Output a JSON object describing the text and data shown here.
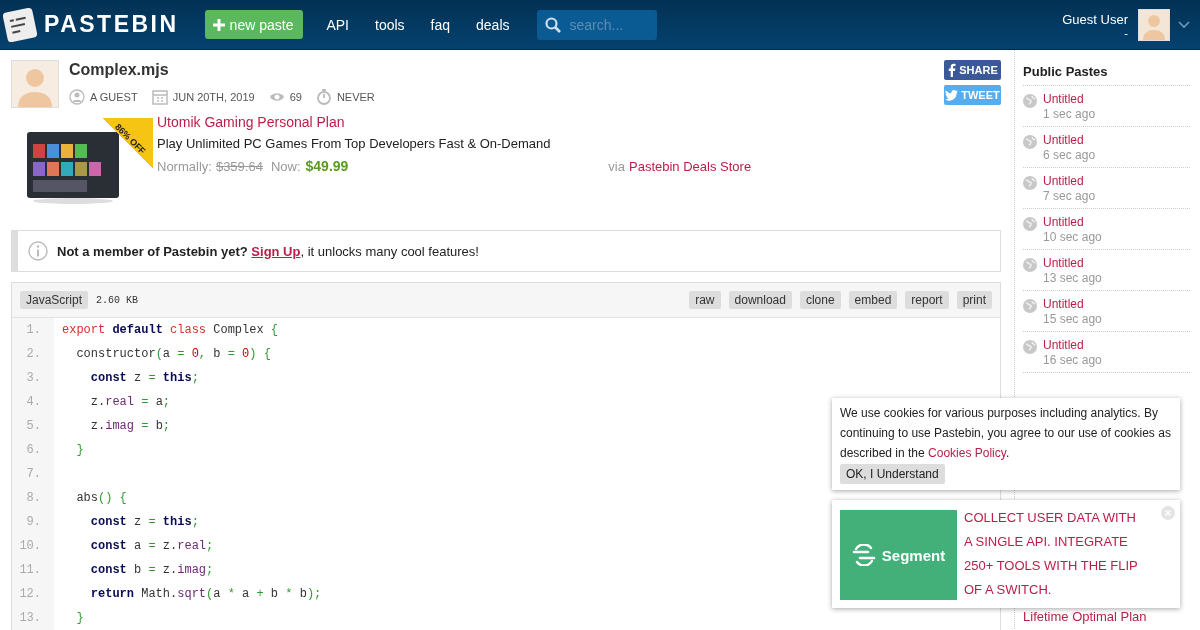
{
  "header": {
    "logo_text": "PASTEBIN",
    "new_paste": "new paste",
    "nav": [
      "API",
      "tools",
      "faq",
      "deals"
    ],
    "search": {
      "placeholder": "search..."
    },
    "user": {
      "name": "Guest User",
      "sub": "-"
    }
  },
  "paste": {
    "title": "Complex.mjs",
    "meta": [
      {
        "kind": "user",
        "text": "A GUEST"
      },
      {
        "kind": "date",
        "text": "JUN 20TH, 2019"
      },
      {
        "kind": "views",
        "text": "69"
      },
      {
        "kind": "expire",
        "text": "NEVER"
      }
    ],
    "share": [
      {
        "kind": "facebook",
        "label": "SHARE"
      },
      {
        "kind": "twitter",
        "label": "TWEET"
      }
    ]
  },
  "deal": {
    "badge": "86% OFF",
    "title": "Utomik Gaming Personal Plan",
    "subtitle": "Play Unlimited PC Games From Top Developers Fast & On-Demand",
    "normally_label": "Normally:",
    "old_price": "$359.64",
    "now_label": "Now:",
    "price": "$49.99",
    "via": "via",
    "store": "Pastebin Deals Store"
  },
  "notice": {
    "text": "Not a member of Pastebin yet?",
    "link": "Sign Up",
    "rest": ", it unlocks many cool features!"
  },
  "code": {
    "language": "JavaScript",
    "size": "2.60 KB",
    "actions": [
      "raw",
      "download",
      "clone",
      "embed",
      "report",
      "print"
    ],
    "lines": [
      {
        "n": "1.",
        "tokens": [
          {
            "t": "export",
            "kind": "keyword"
          },
          {
            "t": " default",
            "kind": "reserved"
          },
          {
            "t": " class",
            "kind": "keyword"
          },
          {
            "t": " Complex ",
            "kind": "plain"
          },
          {
            "t": "{",
            "kind": "punct"
          }
        ]
      },
      {
        "n": "2.",
        "tokens": [
          {
            "t": "  constructor",
            "kind": "plain"
          },
          {
            "t": "(",
            "kind": "punct"
          },
          {
            "t": "a ",
            "kind": "plain"
          },
          {
            "t": "=",
            "kind": "punct"
          },
          {
            "t": " 0",
            "kind": "number"
          },
          {
            "t": ",",
            "kind": "punct"
          },
          {
            "t": " b ",
            "kind": "plain"
          },
          {
            "t": "=",
            "kind": "punct"
          },
          {
            "t": " 0",
            "kind": "number"
          },
          {
            "t": ")",
            "kind": "punct"
          },
          {
            "t": " {",
            "kind": "punct"
          }
        ]
      },
      {
        "n": "3.",
        "tokens": [
          {
            "t": "    const",
            "kind": "reserved"
          },
          {
            "t": " z ",
            "kind": "plain"
          },
          {
            "t": "=",
            "kind": "punct"
          },
          {
            "t": " this",
            "kind": "reserved"
          },
          {
            "t": ";",
            "kind": "punct"
          }
        ]
      },
      {
        "n": "4.",
        "tokens": [
          {
            "t": "    z.",
            "kind": "plain"
          },
          {
            "t": "real",
            "kind": "property"
          },
          {
            "t": " =",
            "kind": "punct"
          },
          {
            "t": " a",
            "kind": "plain"
          },
          {
            "t": ";",
            "kind": "punct"
          }
        ]
      },
      {
        "n": "5.",
        "tokens": [
          {
            "t": "    z.",
            "kind": "plain"
          },
          {
            "t": "imag",
            "kind": "property"
          },
          {
            "t": " =",
            "kind": "punct"
          },
          {
            "t": " b",
            "kind": "plain"
          },
          {
            "t": ";",
            "kind": "punct"
          }
        ]
      },
      {
        "n": "6.",
        "tokens": [
          {
            "t": "  }",
            "kind": "punct"
          }
        ]
      },
      {
        "n": "7."
      },
      {
        "n": "8.",
        "tokens": [
          {
            "t": "  abs",
            "kind": "plain"
          },
          {
            "t": "()",
            "kind": "punct"
          },
          {
            "t": " {",
            "kind": "punct"
          }
        ]
      },
      {
        "n": "9.",
        "tokens": [
          {
            "t": "    const",
            "kind": "reserved"
          },
          {
            "t": " z ",
            "kind": "plain"
          },
          {
            "t": "=",
            "kind": "punct"
          },
          {
            "t": " this",
            "kind": "reserved"
          },
          {
            "t": ";",
            "kind": "punct"
          }
        ]
      },
      {
        "n": "10.",
        "tokens": [
          {
            "t": "    const",
            "kind": "reserved"
          },
          {
            "t": " a ",
            "kind": "plain"
          },
          {
            "t": "=",
            "kind": "punct"
          },
          {
            "t": " z.",
            "kind": "plain"
          },
          {
            "t": "real",
            "kind": "property"
          },
          {
            "t": ";",
            "kind": "punct"
          }
        ]
      },
      {
        "n": "11.",
        "tokens": [
          {
            "t": "    const",
            "kind": "reserved"
          },
          {
            "t": " b ",
            "kind": "plain"
          },
          {
            "t": "=",
            "kind": "punct"
          },
          {
            "t": " z.",
            "kind": "plain"
          },
          {
            "t": "imag",
            "kind": "property"
          },
          {
            "t": ";",
            "kind": "punct"
          }
        ]
      },
      {
        "n": "12.",
        "tokens": [
          {
            "t": "    return",
            "kind": "reserved"
          },
          {
            "t": " Math.",
            "kind": "plain"
          },
          {
            "t": "sqrt",
            "kind": "property"
          },
          {
            "t": "(",
            "kind": "punct"
          },
          {
            "t": "a ",
            "kind": "plain"
          },
          {
            "t": "*",
            "kind": "punct"
          },
          {
            "t": " a ",
            "kind": "plain"
          },
          {
            "t": "+",
            "kind": "punct"
          },
          {
            "t": " b ",
            "kind": "plain"
          },
          {
            "t": "*",
            "kind": "punct"
          },
          {
            "t": " b",
            "kind": "plain"
          },
          {
            "t": ");",
            "kind": "punct"
          }
        ]
      },
      {
        "n": "13.",
        "tokens": [
          {
            "t": "  }",
            "kind": "punct"
          }
        ]
      }
    ]
  },
  "sidebar": {
    "title": "Public Pastes",
    "items": [
      {
        "title": "Untitled",
        "time": "1 sec ago"
      },
      {
        "title": "Untitled",
        "time": "6 sec ago"
      },
      {
        "title": "Untitled",
        "time": "7 sec ago"
      },
      {
        "title": "Untitled",
        "time": "10 sec ago"
      },
      {
        "title": "Untitled",
        "time": "13 sec ago"
      },
      {
        "title": "Untitled",
        "time": "15 sec ago"
      },
      {
        "title": "Untitled",
        "time": "16 sec ago"
      }
    ],
    "deal_title": "Lifetime Optimal Plan"
  },
  "cookie": {
    "text": "We use cookies for various purposes including analytics. By continuing to use Pastebin, you agree to our use of cookies as described in the",
    "link": "Cookies Policy",
    "after": ".",
    "button": "OK, I Understand"
  },
  "ad": {
    "brand": "Segment",
    "text": "COLLECT USER DATA WITH A SINGLE API. INTEGRATE 250+ TOOLS WITH THE FLIP OF A SWITCH."
  }
}
